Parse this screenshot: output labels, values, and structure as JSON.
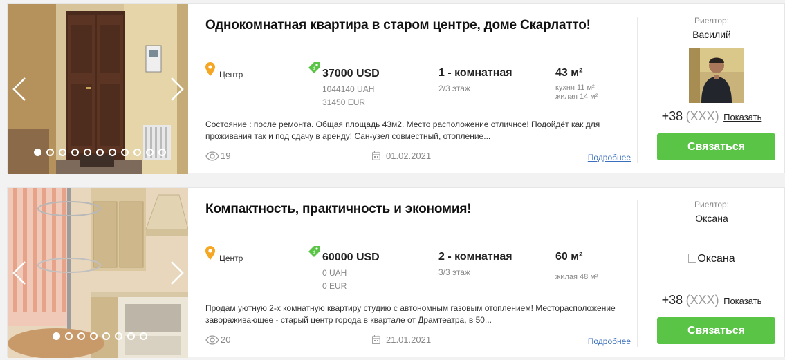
{
  "listings": [
    {
      "title": "Однокомнатная квартира в старом центре, доме Скарлатто!",
      "location": "Центр",
      "price_usd": "37000 USD",
      "price_uah": "1044140 UAH",
      "price_eur": "31450 EUR",
      "rooms": "1 - комнатная",
      "floor": "2/3 этаж",
      "area": "43 м²",
      "kitchen": "кухня 11 м²",
      "living": "жилая 14 м²",
      "description": "Состояние : после ремонта. Общая площадь 43м2. Место расположение отличное! Подойдёт как для проживания так и под сдачу в аренду! Сан-узел совместный, отопление...",
      "views": "19",
      "date": "01.02.2021",
      "more_label": "Подробнее",
      "agent_role": "Риелтор:",
      "agent_name": "Василий",
      "phone_prefix": "+38",
      "phone_mask": "(XXX)",
      "show_label": "Показать",
      "contact_label": "Связаться",
      "photo_count": 11,
      "active_photo": 0
    },
    {
      "title": "Компактность, практичность и экономия!",
      "location": "Центр",
      "price_usd": "60000 USD",
      "price_uah": "0 UAH",
      "price_eur": "0 EUR",
      "rooms": "2 - комнатная",
      "floor": "3/3 этаж",
      "area": "60 м²",
      "living": "жилая 48 м²",
      "description": "Продам уютную 2-х комнатную квартиру студию с автономным газовым отоплением! Месторасположение завораживающее - старый центр города в квартале от Драмтеатра, в 50...",
      "views": "20",
      "date": "21.01.2021",
      "more_label": "Подробнее",
      "agent_role": "Риелтор:",
      "agent_name": "Оксана",
      "avatar_alt": "Оксана",
      "phone_prefix": "+38",
      "phone_mask": "(XXX)",
      "show_label": "Показать",
      "contact_label": "Связаться",
      "photo_count": 8,
      "active_photo": 0
    }
  ],
  "colors": {
    "contact_button": "#5ac447",
    "location_pin": "#f5a623",
    "price_tag": "#5ac447",
    "link": "#3a6fbf"
  },
  "icons": {
    "location": "map-pin-icon",
    "price": "price-tag-icon",
    "views": "eye-icon",
    "date": "calendar-icon",
    "prev": "chevron-left-icon",
    "next": "chevron-right-icon"
  }
}
